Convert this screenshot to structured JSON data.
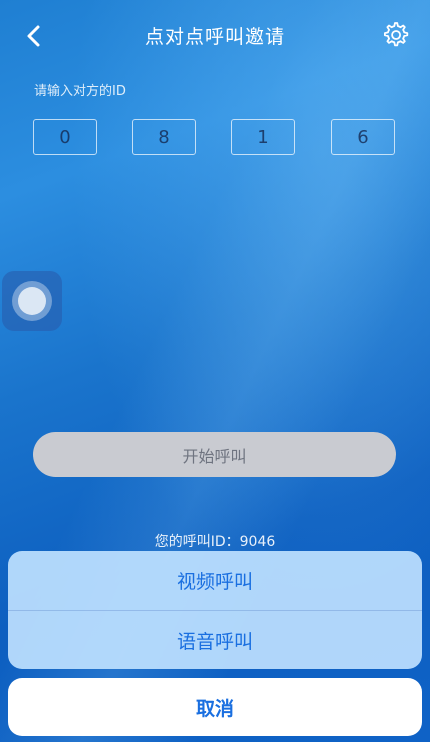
{
  "nav": {
    "title": "点对点呼叫邀请",
    "back_icon": "chevron-left-icon",
    "settings_icon": "gear-icon"
  },
  "id_input": {
    "label": "请输入对方的ID",
    "digits": [
      "0",
      "8",
      "1",
      "6"
    ]
  },
  "start_call": {
    "label": "开始呼叫"
  },
  "my_id": {
    "text": "您的呼叫ID：9046"
  },
  "action_sheet": {
    "options": [
      "视频呼叫",
      "语音呼叫"
    ],
    "cancel_label": "取消"
  },
  "colors": {
    "accent": "#1a6fe0",
    "disabled_button": "#c9cbd1"
  }
}
